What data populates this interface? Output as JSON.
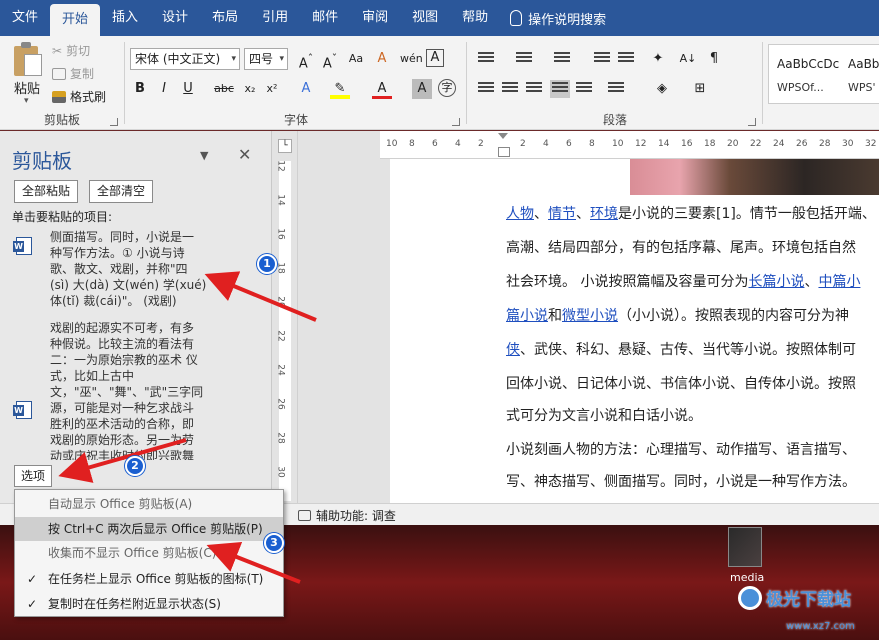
{
  "tabs": [
    "文件",
    "开始",
    "插入",
    "设计",
    "布局",
    "引用",
    "邮件",
    "审阅",
    "视图",
    "帮助"
  ],
  "active_tab": "开始",
  "search_label": "操作说明搜索",
  "ribbon": {
    "clipboard": {
      "label": "剪贴板",
      "paste": "粘贴",
      "cut": "剪切",
      "copy": "复制",
      "format_painter": "格式刷"
    },
    "font": {
      "label": "字体",
      "font_name": "宋体 (中文正文)",
      "font_size": "四号"
    },
    "paragraph": {
      "label": "段落"
    },
    "styles": [
      {
        "preview": "AaBbCcDc",
        "name": "WPSOf..."
      },
      {
        "preview": "AaBb",
        "name": "WPS'"
      }
    ]
  },
  "pane": {
    "title": "剪贴板",
    "paste_all": "全部粘贴",
    "clear_all": "全部清空",
    "instruction": "单击要粘贴的项目:",
    "item1": "侧面描写。同时，小说是一\n种写作方法。① 小说与诗\n歌、散文、戏剧，并称\"四\n(sì) 大(dà) 文(wén) 学(xué)\n体(tǐ) 裁(cái)\"。 (戏剧)",
    "item2": "戏剧的起源实不可考，有多\n种假说。比较主流的看法有\n二：一为原始宗教的巫术 仪\n式，比如上古中\n文，\"巫\"、\"舞\"、\"武\"三字同\n源，可能是对一种乞求战斗\n胜利的巫术活动的合称，即\n戏剧的原始形态。另一为劳\n动或庆祝丰收时的即兴歌舞",
    "options_label": "选项"
  },
  "options_menu": [
    {
      "label": "自动显示 Office 剪贴板(A)",
      "checked": false,
      "highlighted": false,
      "dim": true
    },
    {
      "label": "按 Ctrl+C 两次后显示 Office 剪贴版(P)",
      "checked": false,
      "highlighted": true,
      "dim": false
    },
    {
      "label": "收集而不显示 Office 剪贴板(C)",
      "checked": false,
      "highlighted": false,
      "dim": true
    },
    {
      "label": "在任务栏上显示 Office 剪贴板的图标(T)",
      "checked": true,
      "highlighted": false,
      "dim": false
    },
    {
      "label": "复制时在任务栏附近显示状态(S)",
      "checked": true,
      "highlighted": false,
      "dim": false
    }
  ],
  "check_mark": "✓",
  "rulers": {
    "horizontal": [
      "10",
      "8",
      "6",
      "4",
      "2",
      "2",
      "4",
      "6",
      "8",
      "10",
      "12",
      "14",
      "16",
      "18",
      "20",
      "22",
      "24",
      "26",
      "28",
      "30",
      "32"
    ],
    "vertical": [
      "12",
      "14",
      "16",
      "18",
      "20",
      "22",
      "24",
      "26",
      "28",
      "30"
    ]
  },
  "document": {
    "l1": {
      "a": "人物",
      "b": "、",
      "c": "情节",
      "d": "、",
      "e": "环境",
      "f": "是小说的三要素[1]。情节一般包括开端、"
    },
    "l2": "高潮、结局四部分，有的包括序幕、尾声。环境包括自然",
    "l3": {
      "a": "社会环境。 小说按照篇幅及容量可分为",
      "b": "长篇小说",
      "c": "、",
      "d": "中篇小"
    },
    "l4": {
      "a": "篇小说",
      "b": "和",
      "c": "微型小说",
      "d": "（小小说）。按照表现的内容可分为神"
    },
    "l5": {
      "a": "侠",
      "b": "、武侠、科幻、悬疑、古传、当代等小说。按照体制可"
    },
    "l6": "回体小说、日记体小说、书信体小说、自传体小说。按照",
    "l7": "式可分为文言小说和白话小说。",
    "l8": "小说刻画人物的方法：心理描写、动作描写、语言描写、",
    "l9": "写、神态描写、侧面描写。同时，小说是一种写作方法。"
  },
  "status": {
    "accessibility": "辅助功能: 调查"
  },
  "desktop": {
    "media_label": "media",
    "watermark": "极光下载站",
    "watermark_url": "www.xz7.com"
  },
  "annotations": [
    "1",
    "2",
    "3"
  ],
  "colors": {
    "accent": "#2b579a",
    "link": "#1f4fbf",
    "arrow": "#e02020",
    "badge": "#1a5fd0"
  }
}
